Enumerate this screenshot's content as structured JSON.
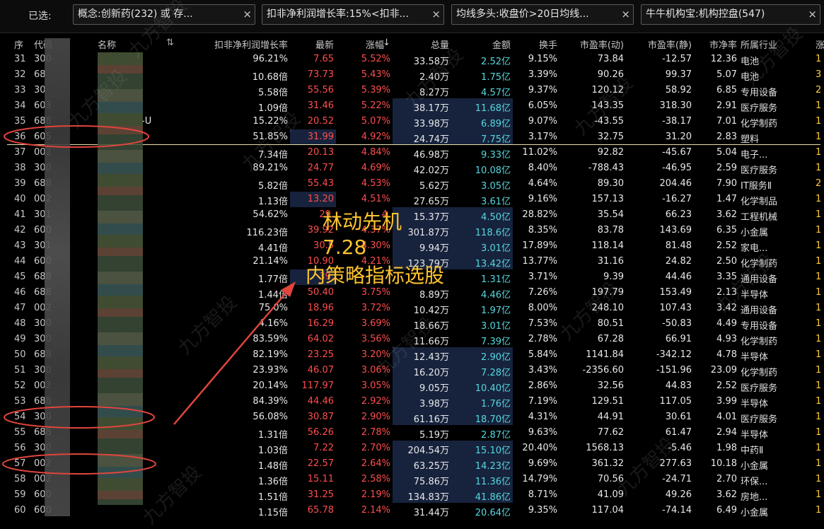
{
  "filter": {
    "label": "已选:",
    "chips": [
      "概念:创新药(232) 或 存...",
      "扣非净利润增长率:15%<扣非...",
      "均线多头:收盘价>20日均线...",
      "牛牛机构宝:机构控盘(547)"
    ],
    "close_glyph": "×"
  },
  "columns": {
    "seq": "序",
    "code": "代码",
    "name": "名称",
    "growth": "扣非净利润增长率",
    "price": "最新",
    "change": "涨幅",
    "change_sort": "↓",
    "volume": "总量",
    "amount": "金额",
    "turnover": "换手",
    "pe_dyn": "市盈率(动)",
    "pe_static": "市盈率(静)",
    "pb": "市净率",
    "industry": "所属行业",
    "more": "涨"
  },
  "rows": [
    {
      "seq": "31",
      "code": "300",
      "name": "",
      "growth": "96.21%",
      "price": "7.65",
      "change": "5.52%",
      "volume": "33.58万",
      "amount": "2.52亿",
      "turnover": "9.15%",
      "pe_dyn": "73.84",
      "pe_static": "-12.57",
      "pb": "12.36",
      "industry": "电池",
      "edge": "1"
    },
    {
      "seq": "32",
      "code": "68",
      "name": "",
      "growth": "10.68倍",
      "price": "73.73",
      "change": "5.43%",
      "volume": "2.40万",
      "amount": "1.75亿",
      "turnover": "3.39%",
      "pe_dyn": "90.26",
      "pe_static": "99.37",
      "pb": "5.07",
      "industry": "电池",
      "edge": "3"
    },
    {
      "seq": "33",
      "code": "30",
      "name": "",
      "growth": "5.58倍",
      "price": "55.56",
      "change": "5.39%",
      "volume": "8.27万",
      "amount": "4.57亿",
      "turnover": "9.37%",
      "pe_dyn": "120.12",
      "pe_static": "58.92",
      "pb": "6.85",
      "industry": "专用设备",
      "edge": "2"
    },
    {
      "seq": "34",
      "code": "603",
      "name": "",
      "growth": "1.09倍",
      "price": "31.46",
      "change": "5.22%",
      "volume": "38.17万",
      "amount": "11.68亿",
      "turnover": "6.05%",
      "pe_dyn": "143.35",
      "pe_static": "318.30",
      "pb": "2.91",
      "industry": "医疗服务",
      "edge": "1"
    },
    {
      "seq": "35",
      "code": "688",
      "name": "-U",
      "growth": "15.22%",
      "price": "20.52",
      "change": "5.07%",
      "volume": "33.98万",
      "amount": "6.89亿",
      "turnover": "9.07%",
      "pe_dyn": "-43.55",
      "pe_static": "-38.17",
      "pb": "7.01",
      "industry": "化学制药",
      "edge": "1"
    },
    {
      "seq": "36",
      "code": "605",
      "name": "",
      "growth": "51.85%",
      "price": "31.99",
      "change": "4.92%",
      "volume": "24.74万",
      "amount": "7.75亿",
      "turnover": "3.17%",
      "pe_dyn": "32.75",
      "pe_static": "31.20",
      "pb": "2.83",
      "industry": "塑料",
      "edge": "1"
    },
    {
      "seq": "37",
      "code": "002",
      "name": "",
      "growth": "7.34倍",
      "price": "20.13",
      "change": "4.84%",
      "volume": "46.98万",
      "amount": "9.33亿",
      "turnover": "11.02%",
      "pe_dyn": "92.82",
      "pe_static": "-45.67",
      "pb": "5.04",
      "industry": "电子...",
      "edge": "1"
    },
    {
      "seq": "38",
      "code": "300",
      "name": "",
      "growth": "89.21%",
      "price": "24.77",
      "change": "4.69%",
      "volume": "42.02万",
      "amount": "10.08亿",
      "turnover": "8.40%",
      "pe_dyn": "-788.43",
      "pe_static": "-46.95",
      "pb": "2.59",
      "industry": "医疗服务",
      "edge": "1"
    },
    {
      "seq": "39",
      "code": "688",
      "name": "",
      "growth": "5.82倍",
      "price": "55.43",
      "change": "4.53%",
      "volume": "5.62万",
      "amount": "3.05亿",
      "turnover": "4.64%",
      "pe_dyn": "89.30",
      "pe_static": "204.46",
      "pb": "7.90",
      "industry": "IT服务Ⅱ",
      "edge": "2"
    },
    {
      "seq": "40",
      "code": "002",
      "name": "",
      "growth": "1.13倍",
      "price": "13.20",
      "change": "4.51%",
      "volume": "27.65万",
      "amount": "3.61亿",
      "turnover": "9.16%",
      "pe_dyn": "157.13",
      "pe_static": "-16.27",
      "pb": "1.47",
      "industry": "化学制品",
      "edge": "1"
    },
    {
      "seq": "41",
      "code": "301",
      "name": "",
      "growth": "54.62%",
      "price": "29.",
      "change": "4.",
      "volume": "15.37万",
      "amount": "4.50亿",
      "turnover": "28.82%",
      "pe_dyn": "35.54",
      "pe_static": "66.23",
      "pb": "3.62",
      "industry": "工程机械",
      "edge": "1"
    },
    {
      "seq": "42",
      "code": "600",
      "name": "",
      "growth": "116.23倍",
      "price": "39.92",
      "change": "4.37%",
      "volume": "301.87万",
      "amount": "118.6亿",
      "turnover": "8.35%",
      "pe_dyn": "83.78",
      "pe_static": "143.69",
      "pb": "6.35",
      "industry": "小金属",
      "edge": "1"
    },
    {
      "seq": "43",
      "code": "301",
      "name": "",
      "growth": "4.41倍",
      "price": "30.5",
      "change": "4.30%",
      "volume": "9.94万",
      "amount": "3.01亿",
      "turnover": "17.89%",
      "pe_dyn": "118.14",
      "pe_static": "81.48",
      "pb": "2.52",
      "industry": "家电...",
      "edge": "1"
    },
    {
      "seq": "44",
      "code": "600",
      "name": "",
      "growth": "21.14%",
      "price": "10.90",
      "change": "4.21%",
      "volume": "123.79万",
      "amount": "13.42亿",
      "turnover": "13.77%",
      "pe_dyn": "31.16",
      "pe_static": "24.82",
      "pb": "2.50",
      "industry": "化学制药",
      "edge": "1"
    },
    {
      "seq": "45",
      "code": "688",
      "name": "",
      "growth": "1.77倍",
      "price": "39.",
      "change": "",
      "volume": "",
      "amount": "1.31亿",
      "turnover": "3.71%",
      "pe_dyn": "9.39",
      "pe_static": "44.46",
      "pb": "3.35",
      "industry": "通用设备",
      "edge": "1"
    },
    {
      "seq": "46",
      "code": "688",
      "name": "",
      "growth": "1.44倍",
      "price": "50.40",
      "change": "3.75%",
      "volume": "8.89万",
      "amount": "4.46亿",
      "turnover": "7.26%",
      "pe_dyn": "197.79",
      "pe_static": "153.49",
      "pb": "2.13",
      "industry": "半导体",
      "edge": "1"
    },
    {
      "seq": "47",
      "code": "002",
      "name": "",
      "growth": "75.0%",
      "price": "18.96",
      "change": "3.72%",
      "volume": "10.42万",
      "amount": "1.97亿",
      "turnover": "8.00%",
      "pe_dyn": "248.10",
      "pe_static": "107.43",
      "pb": "3.42",
      "industry": "通用设备",
      "edge": "1"
    },
    {
      "seq": "48",
      "code": "300",
      "name": "",
      "growth": "4.16%",
      "price": "16.29",
      "change": "3.69%",
      "volume": "18.66万",
      "amount": "3.01亿",
      "turnover": "7.53%",
      "pe_dyn": "80.51",
      "pe_static": "-50.83",
      "pb": "4.49",
      "industry": "专用设备",
      "edge": "1"
    },
    {
      "seq": "49",
      "code": "300",
      "name": "",
      "growth": "83.59%",
      "price": "64.02",
      "change": "3.56%",
      "volume": "11.66万",
      "amount": "7.39亿",
      "turnover": "2.78%",
      "pe_dyn": "67.28",
      "pe_static": "66.91",
      "pb": "4.93",
      "industry": "化学制药",
      "edge": "1"
    },
    {
      "seq": "50",
      "code": "688",
      "name": "",
      "growth": "82.19%",
      "price": "23.25",
      "change": "3.20%",
      "volume": "12.43万",
      "amount": "2.90亿",
      "turnover": "5.84%",
      "pe_dyn": "1141.84",
      "pe_static": "-342.12",
      "pb": "4.78",
      "industry": "半导体",
      "edge": "1"
    },
    {
      "seq": "51",
      "code": "300",
      "name": "",
      "growth": "23.93%",
      "price": "46.07",
      "change": "3.06%",
      "volume": "16.20万",
      "amount": "7.28亿",
      "turnover": "3.43%",
      "pe_dyn": "-2356.60",
      "pe_static": "-151.96",
      "pb": "23.09",
      "industry": "化学制药",
      "edge": "1"
    },
    {
      "seq": "52",
      "code": "002",
      "name": "",
      "growth": "20.14%",
      "price": "117.97",
      "change": "3.05%",
      "volume": "9.05万",
      "amount": "10.40亿",
      "turnover": "2.86%",
      "pe_dyn": "32.56",
      "pe_static": "44.83",
      "pb": "2.52",
      "industry": "医疗服务",
      "edge": "1"
    },
    {
      "seq": "53",
      "code": "688",
      "name": "",
      "growth": "84.39%",
      "price": "44.46",
      "change": "2.92%",
      "volume": "3.98万",
      "amount": "1.76亿",
      "turnover": "7.19%",
      "pe_dyn": "129.51",
      "pe_static": "117.05",
      "pb": "3.99",
      "industry": "半导体",
      "edge": "1"
    },
    {
      "seq": "54",
      "code": "300",
      "name": "",
      "growth": "56.08%",
      "price": "30.87",
      "change": "2.90%",
      "volume": "61.16万",
      "amount": "18.70亿",
      "turnover": "4.31%",
      "pe_dyn": "44.91",
      "pe_static": "30.61",
      "pb": "4.01",
      "industry": "医疗服务",
      "edge": "1"
    },
    {
      "seq": "55",
      "code": "688",
      "name": "",
      "growth": "1.31倍",
      "price": "56.26",
      "change": "2.78%",
      "volume": "5.19万",
      "amount": "2.87亿",
      "turnover": "9.63%",
      "pe_dyn": "77.62",
      "pe_static": "61.47",
      "pb": "2.94",
      "industry": "半导体",
      "edge": "1"
    },
    {
      "seq": "56",
      "code": "300",
      "name": "",
      "growth": "1.03倍",
      "price": "7.22",
      "change": "2.70%",
      "volume": "204.54万",
      "amount": "15.10亿",
      "turnover": "20.40%",
      "pe_dyn": "1568.13",
      "pe_static": "-5.46",
      "pb": "1.98",
      "industry": "中药Ⅱ",
      "edge": "1"
    },
    {
      "seq": "57",
      "code": "002",
      "name": "",
      "growth": "1.48倍",
      "price": "22.57",
      "change": "2.64%",
      "volume": "63.25万",
      "amount": "14.23亿",
      "turnover": "9.69%",
      "pe_dyn": "361.32",
      "pe_static": "277.63",
      "pb": "10.18",
      "industry": "小金属",
      "edge": "1"
    },
    {
      "seq": "58",
      "code": "002",
      "name": "",
      "growth": "1.36倍",
      "price": "15.11",
      "change": "2.58%",
      "volume": "75.86万",
      "amount": "11.36亿",
      "turnover": "14.79%",
      "pe_dyn": "70.56",
      "pe_static": "-24.71",
      "pb": "2.70",
      "industry": "环保...",
      "edge": "1"
    },
    {
      "seq": "59",
      "code": "600",
      "name": "",
      "growth": "1.51倍",
      "price": "31.25",
      "change": "2.19%",
      "volume": "134.83万",
      "amount": "41.86亿",
      "turnover": "8.71%",
      "pe_dyn": "41.09",
      "pe_static": "49.26",
      "pb": "3.62",
      "industry": "房地...",
      "edge": "1"
    },
    {
      "seq": "60",
      "code": "600",
      "name": "",
      "growth": "1.15倍",
      "price": "65.78",
      "change": "2.14%",
      "volume": "31.44万",
      "amount": "20.64亿",
      "turnover": "9.35%",
      "pe_dyn": "117.04",
      "pe_static": "-74.14",
      "pb": "6.49",
      "industry": "小金属",
      "edge": "1"
    }
  ],
  "annotation": {
    "line1": "林动先机",
    "line2": "7.28",
    "line3": "内策略指标选股",
    "color": "#ffc42e"
  },
  "watermark": "九方智投",
  "colors": {
    "up": "#ff4d4d",
    "amount": "#55d8e0",
    "mark": "#e0453c",
    "highlight": "#17233d"
  }
}
